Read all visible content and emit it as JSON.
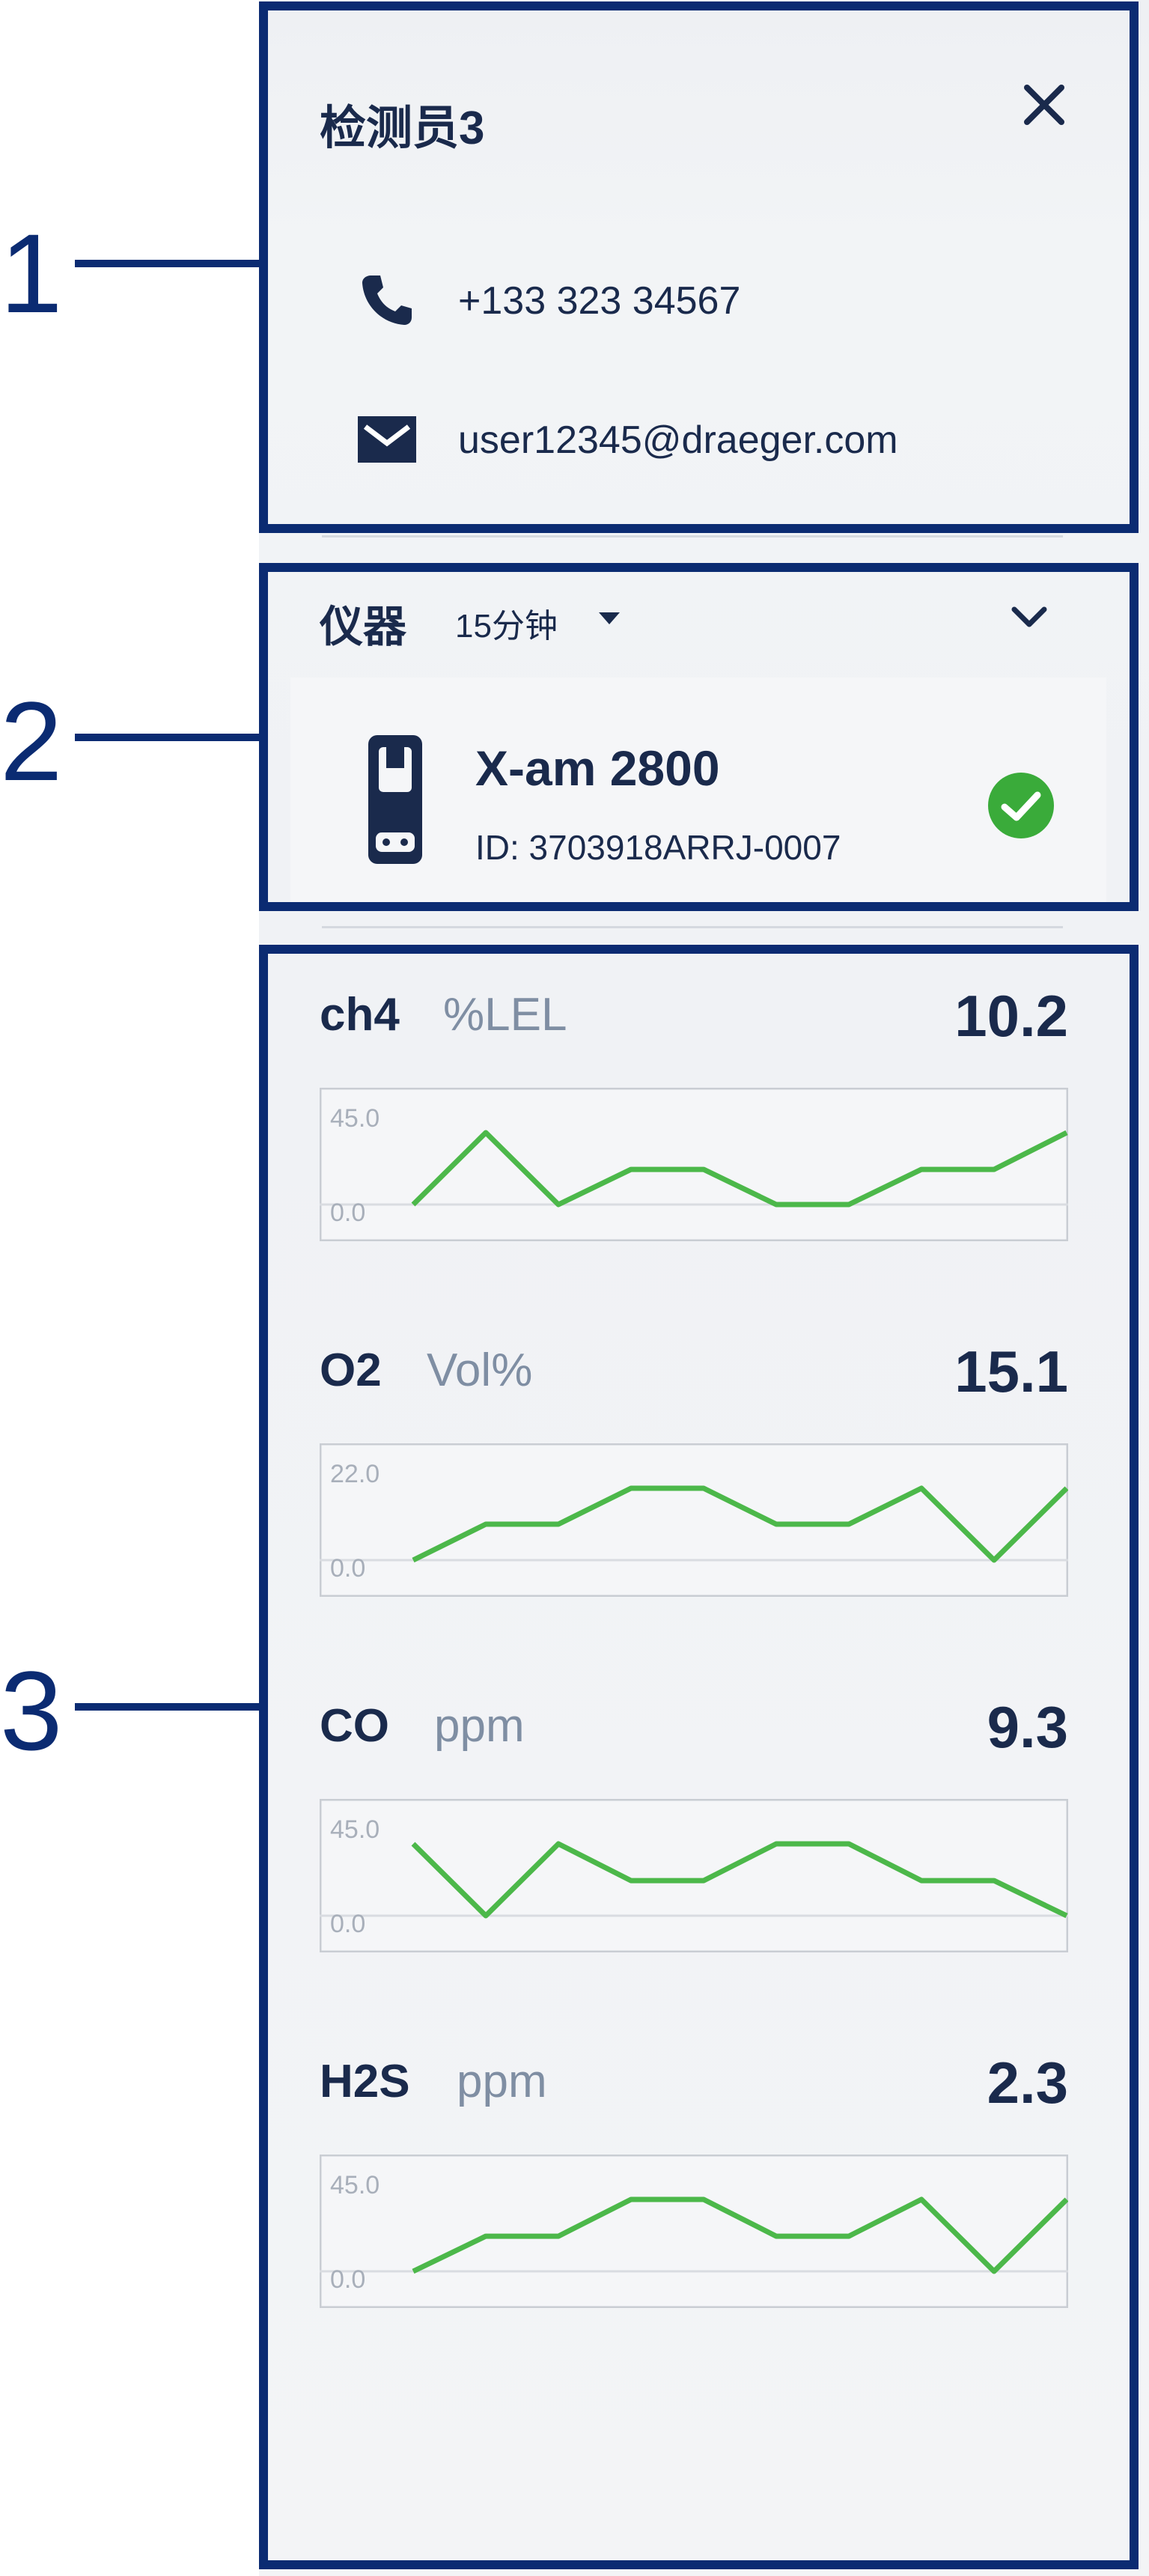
{
  "user": {
    "name": "检测员3",
    "phone": "+133 323 34567",
    "email": "user12345@draeger.com"
  },
  "callouts": [
    "1",
    "2",
    "3"
  ],
  "instrument": {
    "section_label": "仪器",
    "time_range": "15分钟",
    "device_name": "X-am 2800",
    "device_id": "ID: 3703918ARRJ-0007",
    "status_icon": "check-circle-icon",
    "status_color": "#3aab3a"
  },
  "colors": {
    "frame": "#0b2b72",
    "line": "#4cb84a",
    "text": "#1a2a4c",
    "unit": "#7f8ea3"
  },
  "chart_data": [
    {
      "type": "line",
      "gas": "ch4",
      "unit": "%LEL",
      "current": "10.2",
      "ylim": [
        0,
        45
      ],
      "y_max_label": "45.0",
      "y_min_label": "0.0",
      "values": [
        0,
        45,
        0,
        22,
        22,
        0,
        0,
        22,
        22,
        45
      ]
    },
    {
      "type": "line",
      "gas": "O2",
      "unit": "Vol%",
      "current": "15.1",
      "ylim": [
        0,
        22
      ],
      "y_max_label": "22.0",
      "y_min_label": "0.0",
      "values": [
        0,
        11,
        11,
        22,
        22,
        11,
        11,
        22,
        0,
        22
      ]
    },
    {
      "type": "line",
      "gas": "CO",
      "unit": "ppm",
      "current": "9.3",
      "ylim": [
        0,
        45
      ],
      "y_max_label": "45.0",
      "y_min_label": "0.0",
      "values": [
        45,
        0,
        45,
        22,
        22,
        45,
        45,
        22,
        22,
        0
      ]
    },
    {
      "type": "line",
      "gas": "H2S",
      "unit": "ppm",
      "current": "2.3",
      "ylim": [
        0,
        45
      ],
      "y_max_label": "45.0",
      "y_min_label": "0.0",
      "values": [
        0,
        22,
        22,
        45,
        45,
        22,
        22,
        45,
        0,
        45
      ]
    }
  ]
}
